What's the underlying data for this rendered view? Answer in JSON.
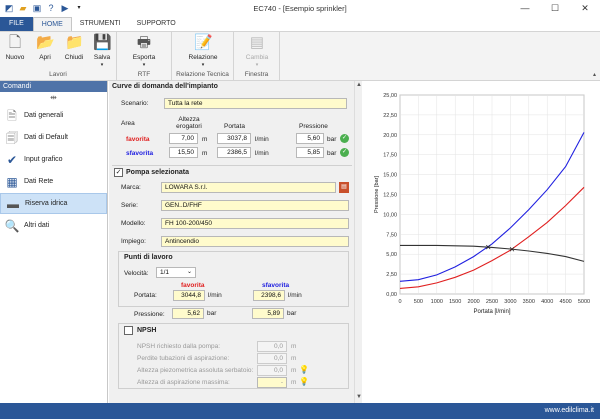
{
  "window": {
    "title": "EC740 - [Esempio sprinkler]"
  },
  "tabs": [
    "FILE",
    "HOME",
    "STRUMENTI",
    "SUPPORTO"
  ],
  "ribbon": {
    "lavori": {
      "label": "Lavori",
      "buttons": [
        "Nuovo",
        "Apri",
        "Chiudi",
        "Salva"
      ]
    },
    "rtf": {
      "label": "RTF",
      "buttons": [
        "Esporta"
      ]
    },
    "relazione": {
      "label": "Relazione Tecnica",
      "buttons": [
        "Relazione"
      ]
    },
    "finestra": {
      "label": "Finestra",
      "buttons": [
        "Cambia"
      ]
    }
  },
  "sidebar": {
    "title": "Comandi",
    "items": [
      "Dati generali",
      "Dati di Default",
      "Input grafico",
      "Dati Rete",
      "Riserva idrica",
      "Altri dati"
    ]
  },
  "curve": {
    "title": "Curve di domanda dell'impianto",
    "scenario_label": "Scenario:",
    "scenario_value": "Tutta la rete",
    "col_area": "Area",
    "col_altezza": "Altezza erogatori",
    "col_portata": "Portata",
    "col_pressione": "Pressione",
    "rows": [
      {
        "name": "favorita",
        "altezza": "7,00",
        "u1": "m",
        "portata": "3037,8",
        "u2": "l/min",
        "pressione": "5,60",
        "u3": "bar"
      },
      {
        "name": "sfavorita",
        "altezza": "15,50",
        "u1": "m",
        "portata": "2386,5",
        "u2": "l/min",
        "pressione": "5,85",
        "u3": "bar"
      }
    ]
  },
  "pump": {
    "title": "Pompa selezionata",
    "marca_label": "Marca:",
    "marca": "LOWARA S.r.l.",
    "serie_label": "Serie:",
    "serie": "GEN..D/FHF",
    "modello_label": "Modello:",
    "modello": "FH 100-200/450",
    "impiego_label": "Impiego:",
    "impiego": "Antincendio"
  },
  "punti": {
    "title": "Punti di lavoro",
    "velocita_label": "Velocità:",
    "velocita": "1/1",
    "favorita": "favorita",
    "sfavorita": "sfavorita",
    "portata_label": "Portata:",
    "pressione_label": "Pressione:",
    "fav_portata": "3044,8",
    "fav_pressione": "5,62",
    "sfav_portata": "2398,6",
    "sfav_pressione": "5,89",
    "u_portata": "l/min",
    "u_pressione": "bar"
  },
  "npsh": {
    "title": "NPSH",
    "rows": [
      {
        "label": "NPSH richiesto dalla pompa:",
        "value": "0,0",
        "unit": "m"
      },
      {
        "label": "Perdite tubazioni di aspirazione:",
        "value": "0,0",
        "unit": "m"
      },
      {
        "label": "Altezza piezometrica assoluta serbatoio:",
        "value": "0,0",
        "unit": "m"
      },
      {
        "label": "Altezza di aspirazione massima:",
        "value": "-",
        "unit": "m"
      }
    ]
  },
  "status": {
    "site": "www.edilclima.it"
  },
  "colors": {
    "accent": "#2b5797",
    "favorita": "#e02020",
    "sfavorita": "#2020e0",
    "pump": "#333333"
  },
  "chart_data": {
    "type": "line",
    "xlabel": "Portata [l/min]",
    "ylabel": "Pressione [bar]",
    "xlim": [
      0,
      5000
    ],
    "ylim": [
      0,
      25
    ],
    "xticks": [
      0,
      500,
      1000,
      1500,
      2000,
      2500,
      3000,
      3500,
      4000,
      4500,
      5000
    ],
    "yticks": [
      0,
      2.5,
      5,
      7.5,
      10,
      12.5,
      15,
      17.5,
      20,
      22.5,
      25
    ],
    "ytick_labels": [
      "0,00",
      "2,50",
      "5,00",
      "7,50",
      "10,00",
      "12,50",
      "15,00",
      "17,50",
      "20,00",
      "22,50",
      "25,00"
    ],
    "series": [
      {
        "key": "sfavorita",
        "color": "#2020e0",
        "x": [
          0,
          500,
          1000,
          1500,
          2000,
          2500,
          3000,
          3500,
          4000,
          4500,
          5000
        ],
        "y": [
          1.6,
          1.8,
          2.4,
          3.4,
          4.7,
          6.3,
          8.3,
          10.6,
          13.1,
          16.0,
          20.3
        ]
      },
      {
        "key": "favorita",
        "color": "#e02020",
        "x": [
          0,
          500,
          1000,
          1500,
          2000,
          2500,
          3000,
          3500,
          4000,
          4500,
          5000
        ],
        "y": [
          0.7,
          0.9,
          1.4,
          2.1,
          3.0,
          4.2,
          5.5,
          7.2,
          9.0,
          11.1,
          13.4
        ]
      },
      {
        "key": "pompa",
        "color": "#333333",
        "x": [
          0,
          500,
          1000,
          1500,
          2000,
          2500,
          3000,
          3500,
          4000,
          4500,
          5000
        ],
        "y": [
          6.1,
          6.1,
          6.1,
          6.05,
          6.0,
          5.85,
          5.65,
          5.4,
          5.1,
          4.7,
          4.1
        ]
      }
    ],
    "points": [
      {
        "x": 2398.6,
        "y": 5.89
      },
      {
        "x": 3044.8,
        "y": 5.62
      }
    ],
    "grid": true
  }
}
